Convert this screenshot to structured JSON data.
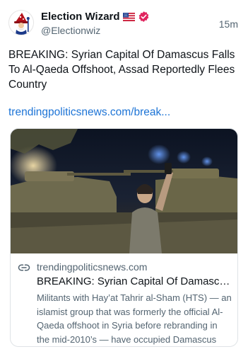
{
  "author": {
    "name": "Election Wizard",
    "flag_icon": "us-flag-icon",
    "verified_icon": "verified-badge-icon",
    "handle": "@Electionwiz"
  },
  "timestamp": "15m",
  "post": {
    "text": "BREAKING: Syrian Capital Of Damascus Falls To Al-Qaeda Offshoot, Assad Reportedly Flees Country",
    "link_text": "trendingpoliticsnews.com/break..."
  },
  "card": {
    "link_icon": "link-icon",
    "domain": "trendingpoliticsnews.com",
    "title": "BREAKING: Syrian Capital Of Damascus Falls To Al-Qaeda Offshoot, Assad Reportedly Flees Country",
    "description": "Militants with Hay’at Tahrir al-Sham (HTS) — an islamist group that was formerly the official Al-Qaeda offshoot in Syria before rebranding in the mid-2010’s — have occupied Damascus"
  },
  "colors": {
    "accent_link": "#1d74d6",
    "verified": "#e0245e",
    "secondary_text": "#536471"
  }
}
